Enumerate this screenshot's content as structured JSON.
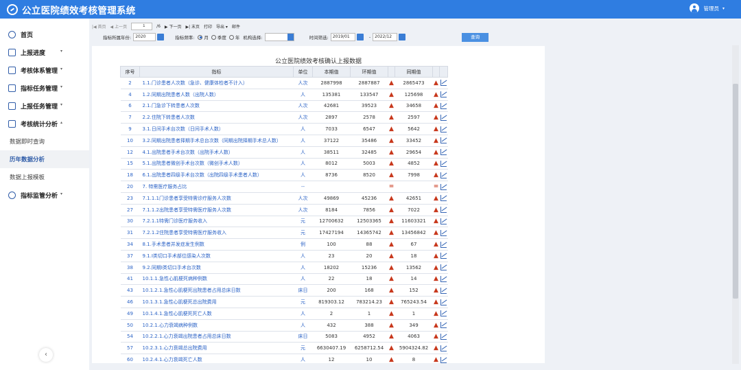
{
  "app": {
    "title": "公立医院绩效考核管理系统",
    "user": "管理员"
  },
  "sidebar": {
    "items": [
      {
        "label": "首页",
        "icon": "clock-icon",
        "arrow": ""
      },
      {
        "label": "上报进度",
        "icon": "clipboard-icon",
        "arrow": "▾"
      },
      {
        "label": "考核体系管理",
        "icon": "monitor-icon",
        "arrow": "▾"
      },
      {
        "label": "指标任务管理",
        "icon": "document-icon",
        "arrow": "▾"
      },
      {
        "label": "上报任务管理",
        "icon": "document-icon",
        "arrow": "▾"
      },
      {
        "label": "考核统计分析",
        "icon": "chart-icon",
        "arrow": "▴"
      }
    ],
    "subitems": [
      "数据即时查询",
      "历年数据分析",
      "数据上报模板"
    ],
    "last_item": {
      "label": "指标监管分析",
      "icon": "clock-icon",
      "arrow": "▾"
    },
    "collapse": "‹"
  },
  "toolbar": {
    "first": "|◀ 首页",
    "prev": "◀ 上一页",
    "page": "1",
    "total": "/6",
    "next": "▶ 下一页",
    "last": "▶| 末页",
    "print": "打印",
    "export": "导出 ▾",
    "mail": "邮件"
  },
  "filters": {
    "year_label": "指标所属年份:",
    "year": "2020",
    "freq_label": "指标频率:",
    "freq_month": "月",
    "freq_quarter": "季度",
    "freq_year": "年",
    "org_label": "机构选择:",
    "time_label": "时间筛选:",
    "start": "2019/01",
    "dash": "-",
    "end": "2022/12",
    "query": "查询"
  },
  "report": {
    "title": "公立医院绩效考核确认上报数据",
    "headers": [
      "序号",
      "指标",
      "单位",
      "本期值",
      "环期值",
      "",
      "同期值",
      "",
      ""
    ],
    "rows": [
      [
        "2",
        "1.1.门诊患者人次数（急诊、健康体检者不计入）",
        "人次",
        "2887998",
        "2887887",
        "▲",
        "2865473",
        "▲"
      ],
      [
        "4",
        "1.2.同期出院患者人数（出院人数）",
        "人",
        "135381",
        "133547",
        "▲",
        "125698",
        "▲"
      ],
      [
        "6",
        "2.1.门急诊下转患者人次数",
        "人次",
        "42681",
        "39523",
        "▲",
        "34658",
        "▲"
      ],
      [
        "7",
        "2.2.住院下转患者人次数",
        "人次",
        "2897",
        "2578",
        "▲",
        "2597",
        "▲"
      ],
      [
        "9",
        "3.1.日间手术台次数（日间手术人数）",
        "人",
        "7033",
        "6547",
        "▲",
        "5642",
        "▲"
      ],
      [
        "10",
        "3.2.同期出院患者择期手术总台次数（同期出院择期手术总人数）",
        "人",
        "37122",
        "35486",
        "▲",
        "33452",
        "▲"
      ],
      [
        "12",
        "4.1.出院患者手术台次数（出院手术人数）",
        "人",
        "38511",
        "32485",
        "▲",
        "29654",
        "▲"
      ],
      [
        "15",
        "5.1.出院患者微创手术台次数（微创手术人数）",
        "人",
        "8012",
        "5003",
        "▲",
        "4852",
        "▲"
      ],
      [
        "18",
        "6.1.出院患者四级手术台次数（出院四级手术患者人数）",
        "人",
        "8736",
        "8520",
        "▲",
        "7998",
        "▲"
      ],
      [
        "20",
        "7. 特需医疗服务占比",
        "--",
        "",
        "",
        "=",
        "",
        "="
      ],
      [
        "23",
        "7.1.1.1门诊患者享受特需诊疗服务人次数",
        "人次",
        "49869",
        "45236",
        "▲",
        "42651",
        "▲"
      ],
      [
        "27",
        "7.1.1.2出院患者享受特需医疗服务人次数",
        "人次",
        "8184",
        "7856",
        "▲",
        "7022",
        "▲"
      ],
      [
        "30",
        "7.2.1.1特需门诊医疗服务收入",
        "元",
        "12700632",
        "12503365",
        "▲",
        "11603321",
        "▲"
      ],
      [
        "31",
        "7.2.1.2住院患者享受特需医疗服务收入",
        "元",
        "17427194",
        "14365742",
        "▲",
        "13456842",
        "▲"
      ],
      [
        "34",
        "8.1.手术患者并发症发生例数",
        "例",
        "100",
        "88",
        "▲",
        "67",
        "▲"
      ],
      [
        "37",
        "9.1.I类切口手术部位感染人次数",
        "人",
        "23",
        "20",
        "▲",
        "18",
        "▲"
      ],
      [
        "38",
        "9.2.同期I类切口手术台次数",
        "人",
        "18202",
        "15236",
        "▲",
        "13562",
        "▲"
      ],
      [
        "41",
        "10.1.1.急性心肌梗死病种例数",
        "人",
        "22",
        "18",
        "▲",
        "14",
        "▲"
      ],
      [
        "43",
        "10.1.2.1.急性心肌梗死出院患者占用总床日数",
        "床日",
        "200",
        "168",
        "▲",
        "152",
        "▲"
      ],
      [
        "46",
        "10.1.3.1.急性心肌梗死总出院费用",
        "元",
        "819303.12",
        "783214.23",
        "▲",
        "765243.54",
        "▲"
      ],
      [
        "49",
        "10.1.4.1.急性心肌梗死死亡人数",
        "人",
        "2",
        "1",
        "▲",
        "1",
        "▲"
      ],
      [
        "50",
        "10.2.1.心力衰竭病种例数",
        "人",
        "432",
        "388",
        "▲",
        "349",
        "▲"
      ],
      [
        "54",
        "10.2.2.1.心力衰竭出院患者占用总床日数",
        "床日",
        "5083",
        "4952",
        "▲",
        "4063",
        "▲"
      ],
      [
        "57",
        "10.2.3.1.心力衰竭总出院费用",
        "元",
        "6630407.19",
        "6258712.54",
        "▲",
        "5904324.82",
        "▲"
      ],
      [
        "60",
        "10.2.4.1.心力衰竭死亡人数",
        "人",
        "12",
        "10",
        "▲",
        "8",
        "▲"
      ]
    ]
  }
}
